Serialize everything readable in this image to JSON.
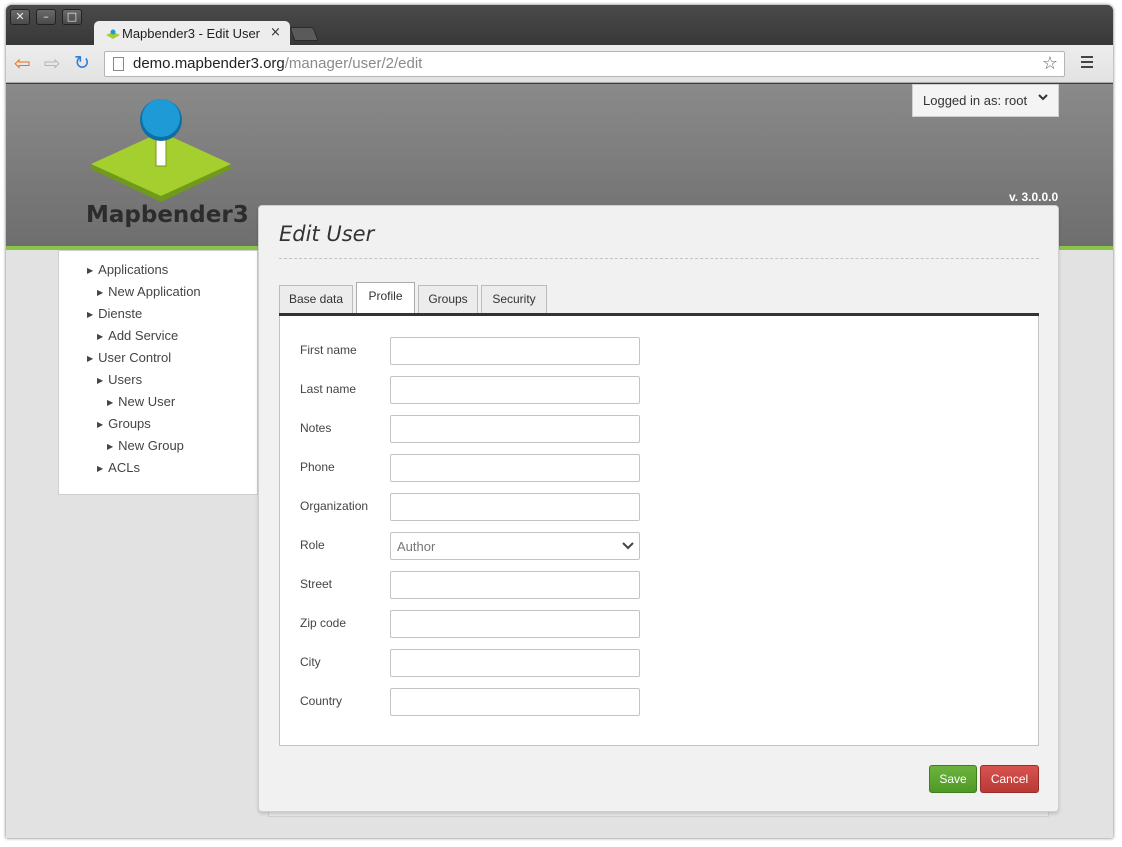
{
  "browser": {
    "window_controls": [
      "✕",
      "–",
      "□"
    ],
    "tab_title": "Mapbender3 - Edit User",
    "tab_close": "×",
    "url_host": "demo.mapbender3.org",
    "url_path": "/manager/user/2/edit"
  },
  "header": {
    "login_label": "Logged in as: root",
    "version": "v. 3.0.0.0",
    "logo_text": "Mapbender3"
  },
  "sidebar": {
    "items": [
      {
        "label": "Applications",
        "level": 0
      },
      {
        "label": "New Application",
        "level": 1
      },
      {
        "label": "Dienste",
        "level": 0
      },
      {
        "label": "Add Service",
        "level": 1
      },
      {
        "label": "User Control",
        "level": 0
      },
      {
        "label": "Users",
        "level": 1
      },
      {
        "label": "New User",
        "level": 2
      },
      {
        "label": "Groups",
        "level": 1
      },
      {
        "label": "New Group",
        "level": 2
      },
      {
        "label": "ACLs",
        "level": 1
      }
    ]
  },
  "panel": {
    "title": "Edit User",
    "tabs": [
      "Base data",
      "Profile",
      "Groups",
      "Security"
    ],
    "active_tab": "Profile"
  },
  "form": {
    "fields": [
      {
        "label": "First name",
        "value": ""
      },
      {
        "label": "Last name",
        "value": ""
      },
      {
        "label": "Notes",
        "value": ""
      },
      {
        "label": "Phone",
        "value": ""
      },
      {
        "label": "Organization",
        "value": ""
      },
      {
        "label": "Role",
        "value": "Author"
      },
      {
        "label": "Street",
        "value": ""
      },
      {
        "label": "Zip code",
        "value": ""
      },
      {
        "label": "City",
        "value": ""
      },
      {
        "label": "Country",
        "value": ""
      }
    ]
  },
  "actions": {
    "save_label": "Save",
    "cancel_label": "Cancel"
  },
  "colors": {
    "accent_green": "#8bc34a",
    "save_button": "#5aa830",
    "cancel_button": "#c9433f",
    "logo_pin": "#1e9ad6",
    "logo_diamond": "#a4cf2e"
  }
}
